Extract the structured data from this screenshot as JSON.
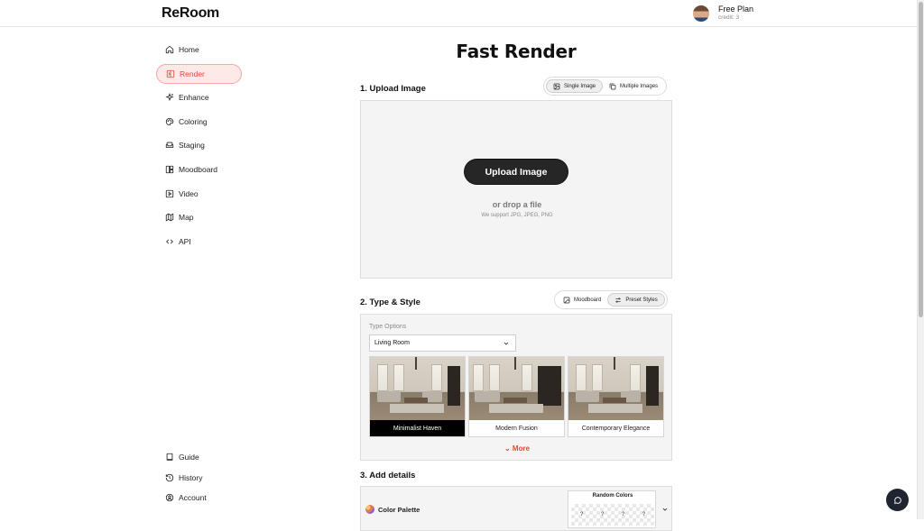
{
  "app": {
    "logo": "ReRoom"
  },
  "user": {
    "plan": "Free Plan",
    "credit": "credit: 3"
  },
  "sidebar": {
    "items": [
      {
        "label": "Home",
        "icon": "home-icon"
      },
      {
        "label": "Render",
        "icon": "render-icon",
        "active": true
      },
      {
        "label": "Enhance",
        "icon": "sparkle-icon"
      },
      {
        "label": "Coloring",
        "icon": "palette-icon"
      },
      {
        "label": "Staging",
        "icon": "sofa-icon"
      },
      {
        "label": "Moodboard",
        "icon": "moodboard-icon"
      },
      {
        "label": "Video",
        "icon": "video-icon"
      },
      {
        "label": "Map",
        "icon": "map-icon"
      },
      {
        "label": "API",
        "icon": "code-icon"
      }
    ],
    "bottom_items": [
      {
        "label": "Guide",
        "icon": "book-icon"
      },
      {
        "label": "History",
        "icon": "history-icon"
      },
      {
        "label": "Account",
        "icon": "account-icon"
      }
    ]
  },
  "main": {
    "title": "Fast Render",
    "upload": {
      "section_title": "1. Upload Image",
      "toggle": {
        "single": "Single Image",
        "multiple": "Multiple Images",
        "selected": "single"
      },
      "button": "Upload Image",
      "drop_text": "or drop a file",
      "support_text": "We support JPG, JPEG, PNG"
    },
    "type_style": {
      "section_title": "2. Type & Style",
      "toggle": {
        "moodboard": "Moodboard",
        "preset": "Preset Styles",
        "selected": "preset"
      },
      "type_label": "Type Options",
      "type_value": "Living Room",
      "styles": [
        {
          "label": "Minimalist Haven",
          "selected": true
        },
        {
          "label": "Modern Fusion",
          "selected": false
        },
        {
          "label": "Contemporary Elegance",
          "selected": false
        }
      ],
      "more": "More"
    },
    "details": {
      "section_title": "3. Add details",
      "palette_label": "Color Palette",
      "random_title": "Random Colors",
      "swatches": [
        "?",
        "?",
        "?",
        "?"
      ]
    }
  },
  "colors": {
    "accent": "#e5483a",
    "dark_button": "#262626"
  }
}
